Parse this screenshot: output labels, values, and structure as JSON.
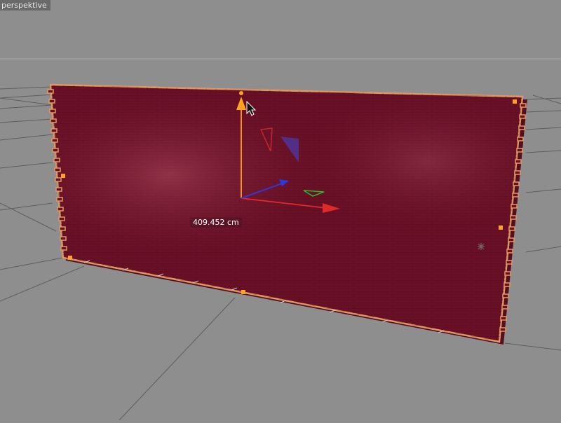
{
  "viewport": {
    "view_name": "perspektive",
    "measurement": "409.452 cm"
  },
  "colors": {
    "background": "#8e8e8e",
    "wall": "#6a1026",
    "wall_edge": "#e09a60",
    "selection_handle": "#ffa21e",
    "axis_x": "#e02a2a",
    "axis_y": "#ffa21e",
    "axis_z": "#2a3ae0",
    "axis_green": "#2ab82a"
  },
  "icons": [
    "mouse-cursor-icon",
    "light-star-icon"
  ]
}
